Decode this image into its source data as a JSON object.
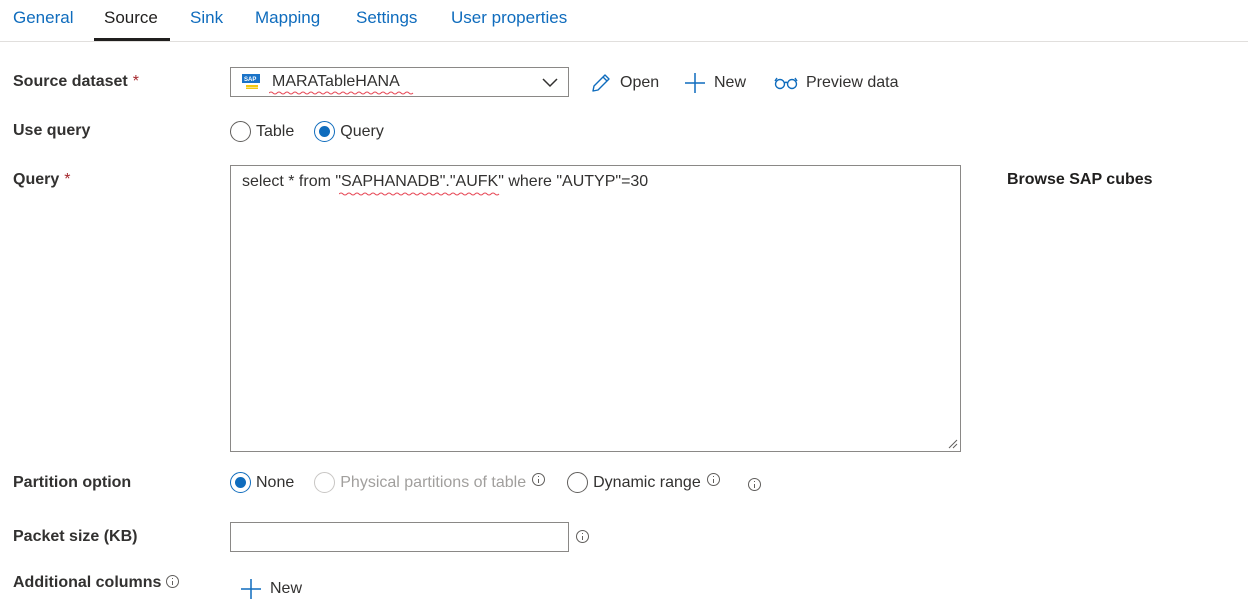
{
  "tabs": [
    {
      "label": "General"
    },
    {
      "label": "Source"
    },
    {
      "label": "Sink"
    },
    {
      "label": "Mapping"
    },
    {
      "label": "Settings"
    },
    {
      "label": "User properties"
    }
  ],
  "active_tab": "Source",
  "source_dataset": {
    "label": "Source dataset",
    "required_mark": "*",
    "value": "MARATableHANA",
    "icon": "sap-hana-dataset-icon"
  },
  "actions": {
    "open": "Open",
    "new": "New",
    "preview": "Preview data"
  },
  "use_query": {
    "label": "Use query",
    "options": [
      "Table",
      "Query"
    ],
    "selected": "Query"
  },
  "query": {
    "label": "Query",
    "required_mark": "*",
    "value": "select * from \"SAPHANADB\".\"AUFK\" where \"AUTYP\"=30"
  },
  "browse_label": "Browse SAP cubes",
  "partition_option": {
    "label": "Partition option",
    "options": [
      "None",
      "Physical partitions of table",
      "Dynamic range"
    ],
    "selected": "None",
    "disabled": [
      "Physical partitions of table"
    ]
  },
  "packet_size": {
    "label": "Packet size (KB)",
    "value": ""
  },
  "additional_columns": {
    "label": "Additional columns",
    "new_label": "New"
  },
  "colors": {
    "accent": "#0f6cbd",
    "required": "#a4262c",
    "border": "#8a8886",
    "spellcheck": "#e74856"
  }
}
